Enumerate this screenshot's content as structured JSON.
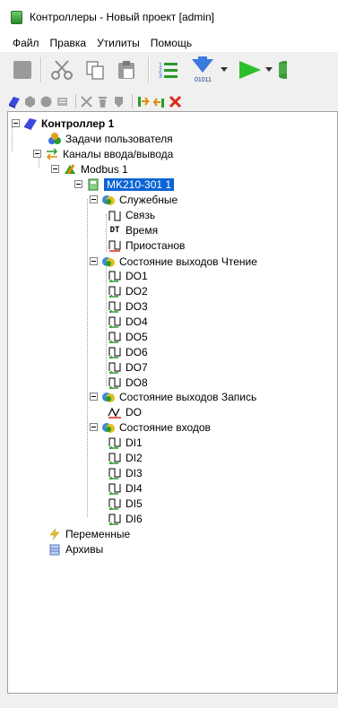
{
  "window": {
    "title": "Контроллеры - Новый проект [admin]"
  },
  "menu": [
    "Файл",
    "Правка",
    "Утилиты",
    "Помощь"
  ],
  "toolbar_icons": [
    "stop-icon",
    "cut-icon",
    "copy-icon",
    "paste-icon",
    "list-icon",
    "compile-icon",
    "dropdown-arrow-icon",
    "run-icon",
    "dropdown-arrow-icon",
    "database-icon"
  ],
  "toolbar": {
    "compile_label": "01011"
  },
  "toolbar2_icons": [
    "controller-icon",
    "add-icon",
    "delete-icon",
    "properties-icon",
    "cut-icon",
    "trash-icon",
    "shield-icon",
    "import-icon",
    "export-icon",
    "close-red-icon"
  ],
  "tree": {
    "controller": "Контроллер 1",
    "user_tasks": "Задачи пользователя",
    "io_channels": "Каналы ввода/вывода",
    "modbus": "Modbus 1",
    "device": "MK210-301 1",
    "service": "Служебные",
    "svyaz": "Связь",
    "vremya": "Время",
    "priostanov": "Приостанов",
    "dt_label": "DT",
    "out_read": "Состояние выходов Чтение",
    "do_items": [
      "DO1",
      "DO2",
      "DO3",
      "DO4",
      "DO5",
      "DO6",
      "DO7",
      "DO8"
    ],
    "out_write": "Состояние выходов Запись",
    "do": "DO",
    "inputs": "Состояние входов",
    "di_items": [
      "DI1",
      "DI2",
      "DI3",
      "DI4",
      "DI5",
      "DI6"
    ],
    "variables": "Переменные",
    "archives": "Архивы"
  }
}
